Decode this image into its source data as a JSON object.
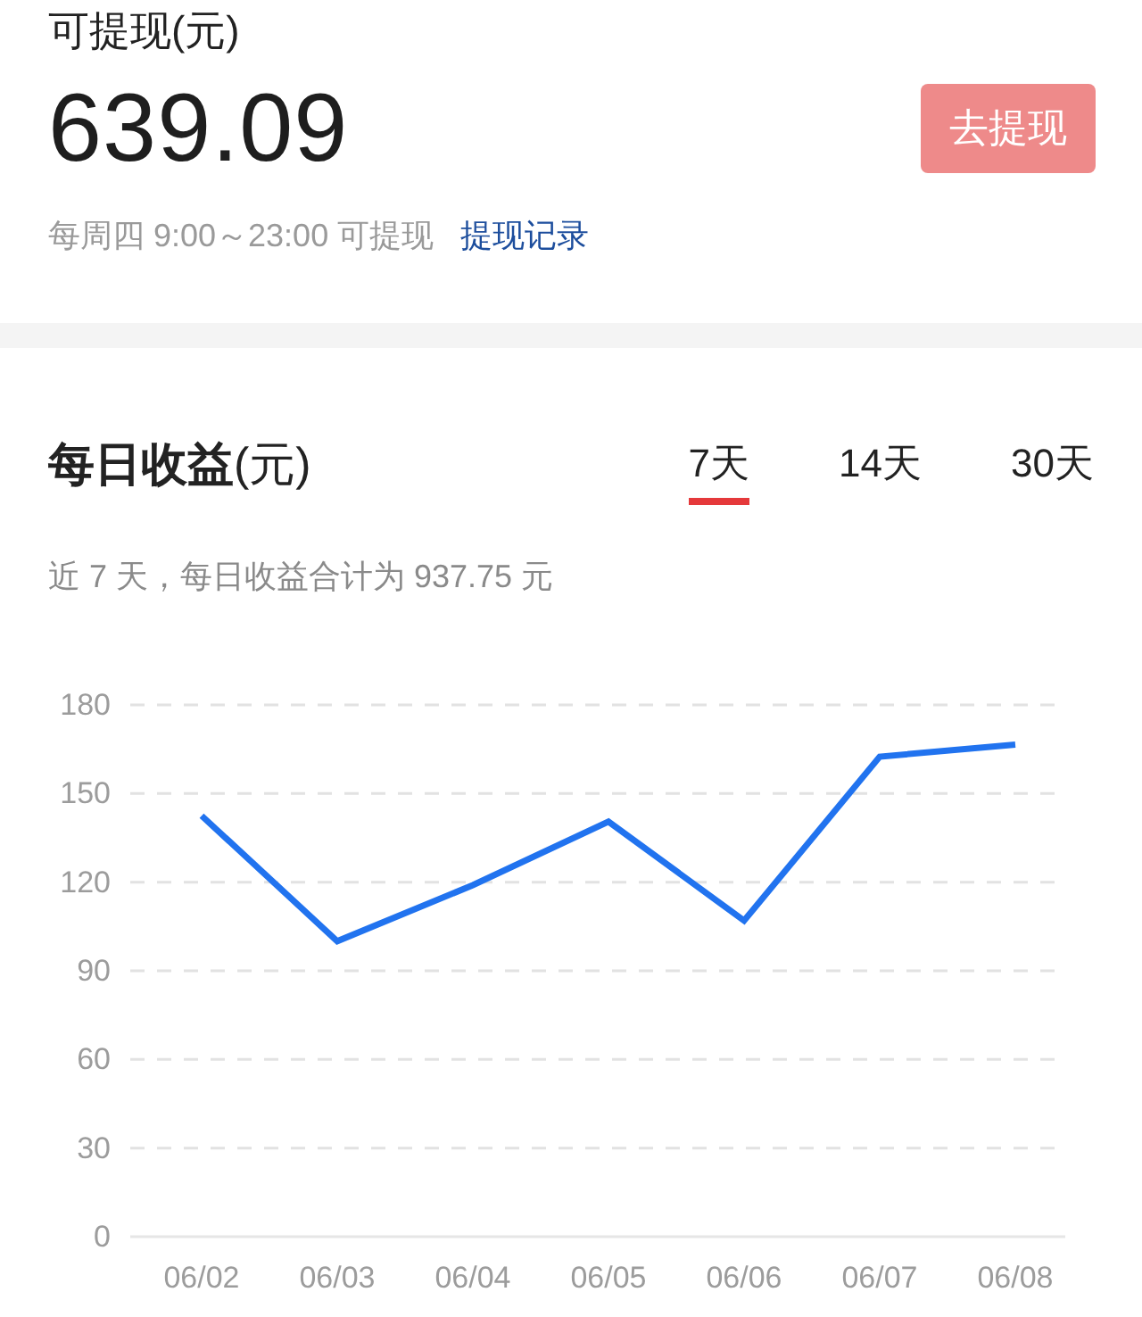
{
  "balance": {
    "label": "可提现(元)",
    "amount": "639.09",
    "withdraw_button": {
      "label": "去提现",
      "disabled": true
    },
    "schedule": "每周四 9:00～23:00 可提现",
    "history_link": "提现记录"
  },
  "daily_earnings": {
    "title": "**每日收益**(元)",
    "tabs": [
      {
        "label": "7天",
        "selected": true
      },
      {
        "label": "14天",
        "selected": false
      },
      {
        "label": "30天",
        "selected": false
      }
    ],
    "summary": "近 7 天，每日收益合计为 937.75 元",
    "chart_data": {
      "type": "line",
      "grid": true,
      "categories": [
        "06/02",
        "06/03",
        "06/04",
        "06/05",
        "06/06",
        "06/07",
        "06/08"
      ],
      "series": [
        {
          "color": "#2173ef",
          "values": [
            142.5,
            100,
            119,
            140.5,
            107,
            162.5,
            166.5
          ]
        }
      ],
      "ylim": [
        0,
        180
      ],
      "yticks": [
        0,
        30,
        60,
        90,
        120,
        150,
        180
      ]
    }
  }
}
